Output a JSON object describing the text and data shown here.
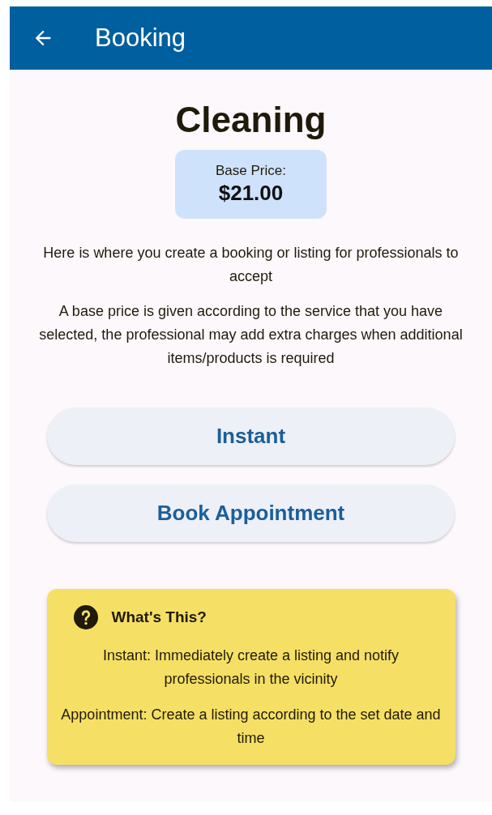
{
  "app_bar": {
    "title": "Booking"
  },
  "service": {
    "title": "Cleaning",
    "price_label": "Base Price:",
    "price": "$21.00"
  },
  "paragraphs": [
    "Here is where you create a booking or listing for professionals to accept",
    "A base price is given according to the service that you have selected, the professional may add extra charges when additional items/products is required"
  ],
  "buttons": [
    "Instant",
    "Book Appointment"
  ],
  "info_card": {
    "title": "What's This?",
    "lines": [
      "Instant: Immediately create a listing and notify professionals in the vicinity",
      "Appointment: Create a listing according to the set date and time"
    ]
  }
}
